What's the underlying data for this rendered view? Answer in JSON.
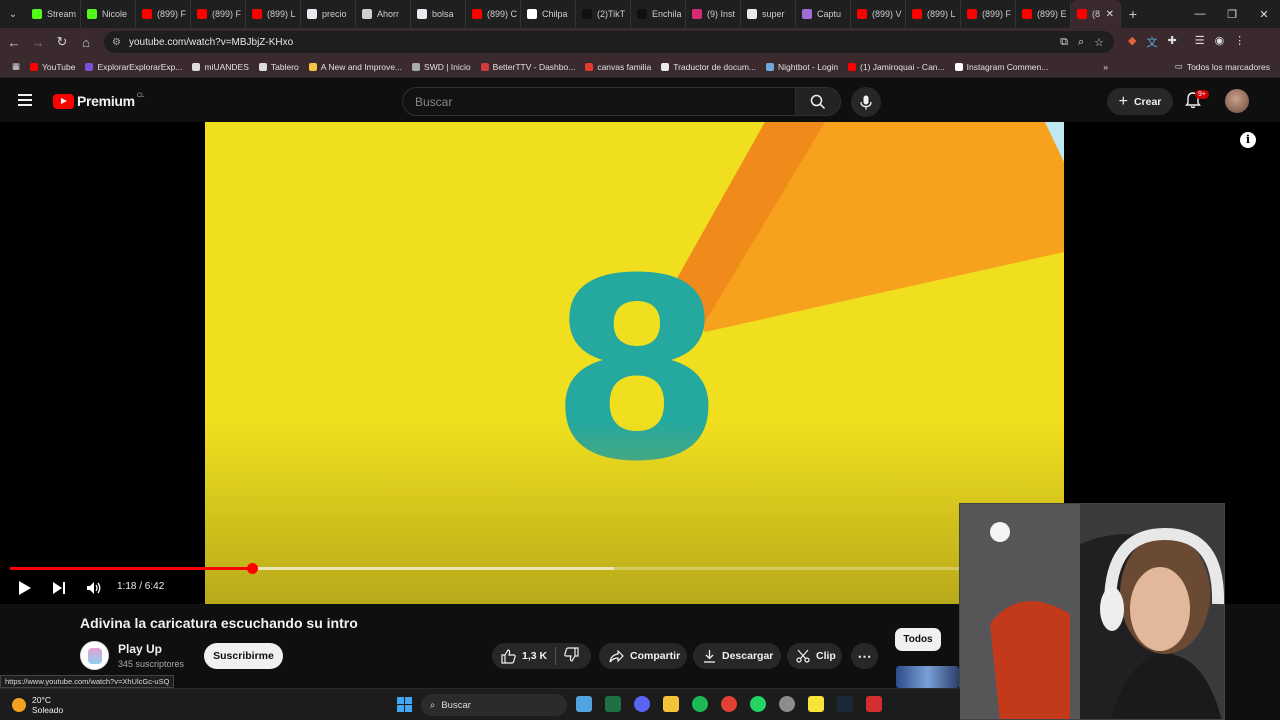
{
  "browser": {
    "tabs": [
      {
        "label": "Stream",
        "color": "#53fc18"
      },
      {
        "label": "Nicole",
        "color": "#53fc18"
      },
      {
        "label": "(899) F",
        "color": "#ff0000"
      },
      {
        "label": "(899) F",
        "color": "#ff0000"
      },
      {
        "label": "(899) L",
        "color": "#ff0000"
      },
      {
        "label": "precio",
        "color": "#e8eaed"
      },
      {
        "label": "Ahorr",
        "color": "#cfcfcf"
      },
      {
        "label": "bolsa",
        "color": "#e8eaed"
      },
      {
        "label": "(899) C",
        "color": "#ff0000"
      },
      {
        "label": "Chilpa",
        "color": "#ffffff"
      },
      {
        "label": "(2)TikT",
        "color": "#111111"
      },
      {
        "label": "Enchila",
        "color": "#111111"
      },
      {
        "label": "(9) Inst",
        "color": "#d62976"
      },
      {
        "label": "super",
        "color": "#e8eaed"
      },
      {
        "label": "Captu",
        "color": "#a06cd5"
      },
      {
        "label": "(899) V",
        "color": "#ff0000"
      },
      {
        "label": "(899) L",
        "color": "#ff0000"
      },
      {
        "label": "(899) F",
        "color": "#ff0000"
      },
      {
        "label": "(899) E",
        "color": "#ff0000"
      }
    ],
    "active_tab": {
      "label": "(8",
      "color": "#ff0000"
    },
    "url": "youtube.com/watch?v=MBJbjZ-KHxo",
    "bookmarks": [
      {
        "label": "YouTube",
        "color": "#ff0000"
      },
      {
        "label": "ExplorarExplorarExp...",
        "color": "#7b4ddb"
      },
      {
        "label": "miUANDES",
        "color": "#dddddd"
      },
      {
        "label": "Tablero",
        "color": "#dddddd"
      },
      {
        "label": "A New and Improve...",
        "color": "#f4c542"
      },
      {
        "label": "SWD | Inicio",
        "color": "#aaaaaa"
      },
      {
        "label": "BetterTTV - Dashbo...",
        "color": "#d43b3b"
      },
      {
        "label": "canvas familia",
        "color": "#e13b2e"
      },
      {
        "label": "Traductor de docum...",
        "color": "#e8eaed"
      },
      {
        "label": "Nightbot - Login",
        "color": "#6fa8dc"
      },
      {
        "label": "(1) Jamiroquai - Can...",
        "color": "#ff0000"
      },
      {
        "label": "Instagram Commen...",
        "color": "#ffffff"
      }
    ],
    "all_bookmarks": "Todos los marcadores",
    "status_url": "https://www.youtube.com/watch?v=XhUlcGc-uSQ"
  },
  "youtube": {
    "logo_text": "Premium",
    "logo_region": "CL",
    "search_placeholder": "Buscar",
    "create_label": "Crear",
    "notifications_badge": "9+",
    "video": {
      "title": "Adivina la caricatura escuchando su intro",
      "time_display": "1:18 / 6:42",
      "progress_fraction": 0.255,
      "buffered_fraction": 0.636,
      "overlay_digit": "8"
    },
    "channel": {
      "name": "Play Up",
      "subscribers": "345 suscriptores",
      "subscribe_label": "Suscribirme"
    },
    "actions": {
      "likes": "1,3 K",
      "share": "Compartir",
      "download": "Descargar",
      "clip": "Clip"
    },
    "chips": [
      "Todos"
    ]
  },
  "taskbar": {
    "weather_temp": "20°C",
    "weather_desc": "Soleado",
    "search_label": "Buscar"
  },
  "colors": {
    "accent": "#ff0000",
    "video_bg": "#f0df1f",
    "digit": "#25a89e"
  }
}
